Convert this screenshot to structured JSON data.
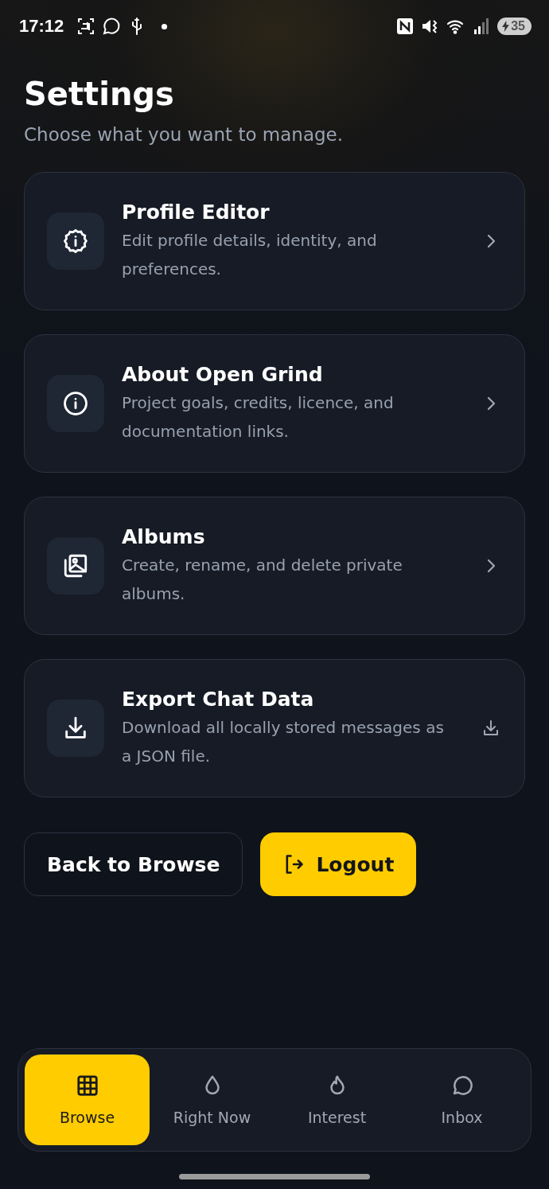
{
  "status_bar": {
    "time": "17:12",
    "battery": "35"
  },
  "header": {
    "title": "Settings",
    "subtitle": "Choose what you want to manage."
  },
  "cards": [
    {
      "title": "Profile Editor",
      "description": "Edit profile details, identity, and preferences."
    },
    {
      "title": "About Open Grind",
      "description": "Project goals, credits, licence, and documentation links."
    },
    {
      "title": "Albums",
      "description": "Create, rename, and delete private albums."
    },
    {
      "title": "Export Chat Data",
      "description": "Download all locally stored messages as a JSON file."
    }
  ],
  "actions": [
    {
      "kind": "outline",
      "label": "Back to Browse"
    },
    {
      "kind": "primary",
      "label": "Logout"
    }
  ],
  "nav": [
    {
      "label": "Browse",
      "selected": true
    },
    {
      "label": "Right Now",
      "selected": false
    },
    {
      "label": "Interest",
      "selected": false
    },
    {
      "label": "Inbox",
      "selected": false
    }
  ]
}
